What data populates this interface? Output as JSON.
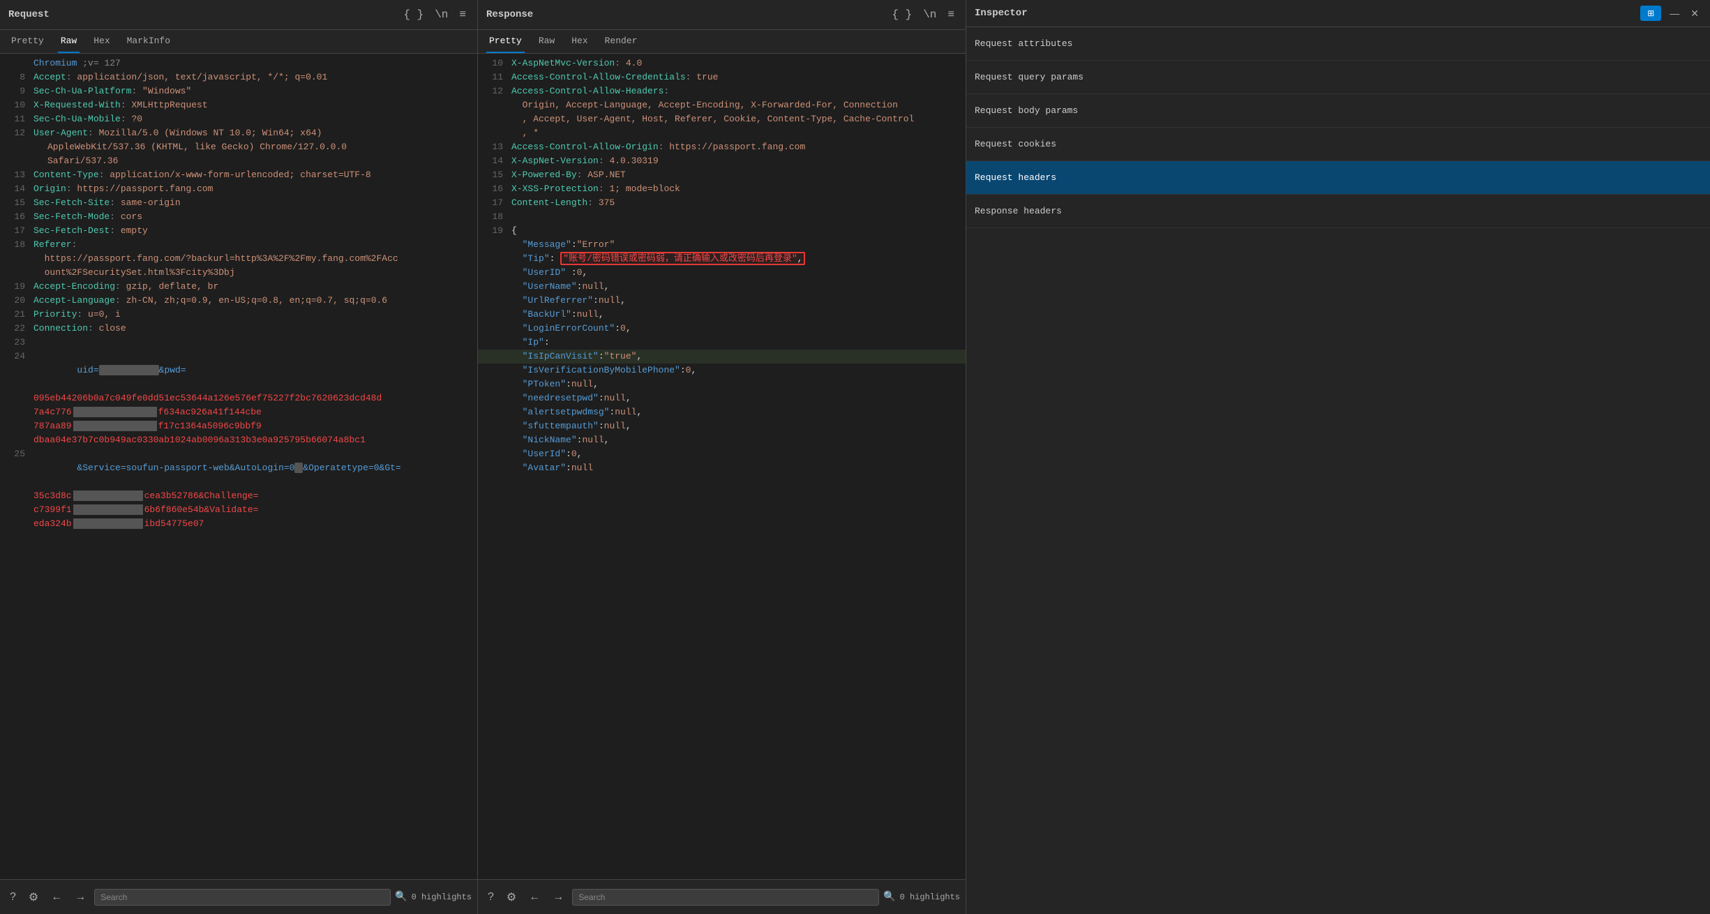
{
  "request": {
    "title": "Request",
    "tabs": [
      "Pretty",
      "Raw",
      "Hex",
      "MarkInfo"
    ],
    "active_tab": "Raw",
    "lines": [
      {
        "num": "",
        "content": "Chromium ;v= 127",
        "type": "plain"
      },
      {
        "num": "8",
        "content": "Accept: application/json, text/javascript, */*; q=0.01",
        "key": "Accept",
        "val": "application/json, text/javascript, */*; q=0.01"
      },
      {
        "num": "9",
        "content": "Sec-Ch-Ua-Platform: \"Windows\"",
        "key": "Sec-Ch-Ua-Platform",
        "val": "\"Windows\""
      },
      {
        "num": "10",
        "content": "X-Requested-With: XMLHttpRequest",
        "key": "X-Requested-With",
        "val": "XMLHttpRequest"
      },
      {
        "num": "11",
        "content": "Sec-Ch-Ua-Mobile: ?0",
        "key": "Sec-Ch-Ua-Mobile",
        "val": "?0"
      },
      {
        "num": "12",
        "content": "User-Agent: Mozilla/5.0 (Windows NT 10.0; Win64; x64) AppleWebKit/537.36 (KHTML, like Gecko) Chrome/127.0.0.0 Safari/537.36",
        "key": "User-Agent",
        "val": "Mozilla/5.0 (Windows NT 10.0; Win64; x64) AppleWebKit/537.36 (KHTML, like Gecko) Chrome/127.0.0.0 Safari/537.36"
      },
      {
        "num": "13",
        "content": "Content-Type: application/x-www-form-urlencoded; charset=UTF-8",
        "key": "Content-Type",
        "val": "application/x-www-form-urlencoded; charset=UTF-8"
      },
      {
        "num": "14",
        "content": "Origin: https://passport.fang.com",
        "key": "Origin",
        "val": "https://passport.fang.com"
      },
      {
        "num": "15",
        "content": "Sec-Fetch-Site: same-origin",
        "key": "Sec-Fetch-Site",
        "val": "same-origin"
      },
      {
        "num": "16",
        "content": "Sec-Fetch-Mode: cors",
        "key": "Sec-Fetch-Mode",
        "val": "cors"
      },
      {
        "num": "17",
        "content": "Sec-Fetch-Dest: empty",
        "key": "Sec-Fetch-Dest",
        "val": "empty"
      },
      {
        "num": "18",
        "content": "Referer:",
        "key": "Referer",
        "val": ""
      },
      {
        "num": "",
        "content": "  https://passport.fang.com/?backurl=http%3A%2F%2Fmy.fang.com%2FAcc ount%2FSecuritySet.html%3Fcity%3Dbj",
        "type": "continuation"
      },
      {
        "num": "19",
        "content": "Accept-Encoding: gzip, deflate, br",
        "key": "Accept-Encoding",
        "val": "gzip, deflate, br"
      },
      {
        "num": "20",
        "content": "Accept-Language: zh-CN, zh;q=0.9, en-US;q=0.8, en;q=0.7, sq;q=0.6",
        "key": "Accept-Language",
        "val": "zh-CN, zh;q=0.9, en-US;q=0.8, en;q=0.7, sq;q=0.6"
      },
      {
        "num": "21",
        "content": "Priority: u=0, i",
        "key": "Priority",
        "val": "u=0, i"
      },
      {
        "num": "22",
        "content": "Connection: close",
        "key": "Connection",
        "val": "close"
      },
      {
        "num": "23",
        "content": "",
        "type": "empty"
      },
      {
        "num": "24",
        "content": "uid=REDACTED1&pwd=",
        "type": "redacted_line"
      },
      {
        "num": "",
        "content": "095eb44206b0a7c049fe0dd51ec53644a126e576ef75227f2bc7620623dcd48d",
        "type": "redacted_part"
      },
      {
        "num": "",
        "content": "7a4c776                          f634ac926a41f144cbe",
        "type": "redacted_part"
      },
      {
        "num": "",
        "content": "787aa89                          f17c1364a5096c9bbf9",
        "type": "redacted_part"
      },
      {
        "num": "",
        "content": "dbaa04e37b7c0b949ac0330ab1024ab0096a313b3e0a925795b66074a8bc1",
        "type": "redacted_part"
      },
      {
        "num": "25",
        "content": "&Service=soufun-passport-web&AutoLogin=0&Operatetype=0&Gt=",
        "type": "redacted_url"
      },
      {
        "num": "",
        "content": "35c3d8c               cea3b52786&Challenge=",
        "type": "redacted_part"
      },
      {
        "num": "",
        "content": "c7399f1               6b6f860e54b&Validate=",
        "type": "redacted_part"
      },
      {
        "num": "",
        "content": "eda324b               ibd54775e07",
        "type": "redacted_part"
      }
    ],
    "bottom": {
      "search_placeholder": "Search",
      "highlights": "0 highlights"
    }
  },
  "response": {
    "title": "Response",
    "tabs": [
      "Pretty",
      "Raw",
      "Hex",
      "Render"
    ],
    "active_tab": "Pretty",
    "lines": [
      {
        "num": "10",
        "content": "X-AspNetMvc-Version: 4.0",
        "key": "X-AspNetMvc-Version",
        "val": "4.0"
      },
      {
        "num": "11",
        "content": "Access-Control-Allow-Credentials: true",
        "key": "Access-Control-Allow-Credentials",
        "val": "true"
      },
      {
        "num": "12",
        "content": "Access-Control-Allow-Headers:",
        "key": "Access-Control-Allow-Headers",
        "val": ""
      },
      {
        "num": "",
        "content": "  Origin, Accept-Language, Accept-Encoding, X-Forwarded-For, Connection, Accept, User-Agent, Host, Referer, Cookie, Content-Type, Cache-Control, *",
        "type": "continuation"
      },
      {
        "num": "13",
        "content": "Access-Control-Allow-Origin: https://passport.fang.com",
        "key": "Access-Control-Allow-Origin",
        "val": "https://passport.fang.com"
      },
      {
        "num": "14",
        "content": "X-AspNet-Version: 4.0.30319",
        "key": "X-AspNet-Version",
        "val": "4.0.30319"
      },
      {
        "num": "15",
        "content": "X-Powered-By: ASP.NET",
        "key": "X-Powered-By",
        "val": "ASP.NET"
      },
      {
        "num": "16",
        "content": "X-XSS-Protection: 1; mode=block",
        "key": "X-XSS-Protection",
        "val": "1; mode=block"
      },
      {
        "num": "17",
        "content": "Content-Length: 375",
        "key": "Content-Length",
        "val": "375"
      },
      {
        "num": "18",
        "content": "",
        "type": "empty"
      },
      {
        "num": "19",
        "content": "{",
        "type": "brace"
      },
      {
        "num": "",
        "content": "  \"Message\":\"Error\"",
        "type": "json_kv",
        "jkey": "Message",
        "jval": "Error"
      },
      {
        "num": "",
        "content": "  \"Tip\": \"账号/密码错误或密码弱，请正确输入或改密码后再登录\",",
        "type": "json_highlight",
        "jkey": "Tip",
        "jval": "账号/密码错误或密码弱，请正确输入或改密码后再登录"
      },
      {
        "num": "",
        "content": "  \"UserID\":0,",
        "type": "json_kv",
        "jkey": "UserID",
        "jval": "0"
      },
      {
        "num": "",
        "content": "  \"UserName\":null,",
        "type": "json_kv",
        "jkey": "UserName",
        "jval": "null"
      },
      {
        "num": "",
        "content": "  \"UrlReferrer\":null,",
        "type": "json_kv",
        "jkey": "UrlReferrer",
        "jval": "null"
      },
      {
        "num": "",
        "content": "  \"BackUrl\":null,",
        "type": "json_kv",
        "jkey": "BackUrl",
        "jval": "null"
      },
      {
        "num": "",
        "content": "  \"LoginErrorCount\":0,",
        "type": "json_kv",
        "jkey": "LoginErrorCount",
        "jval": "0"
      },
      {
        "num": "",
        "content": "  \"Ip\":",
        "type": "json_kv_nocomma",
        "jkey": "Ip",
        "jval": ""
      },
      {
        "num": "",
        "content": "  \"IsIpCanVisit\":\"true\",",
        "type": "json_kv",
        "jkey": "IsIpCanVisit",
        "jval": "true"
      },
      {
        "num": "",
        "content": "  \"IsVerificationByMobilePhone\":0,",
        "type": "json_kv",
        "jkey": "IsVerificationByMobilePhone",
        "jval": "0"
      },
      {
        "num": "",
        "content": "  \"PToken\":null,",
        "type": "json_kv",
        "jkey": "PToken",
        "jval": "null"
      },
      {
        "num": "",
        "content": "  \"needresetpwd\":null,",
        "type": "json_kv",
        "jkey": "needresetpwd",
        "jval": "null"
      },
      {
        "num": "",
        "content": "  \"alertsetpwdmsg\":null,",
        "type": "json_kv",
        "jkey": "alertsetpwdmsg",
        "jval": "null"
      },
      {
        "num": "",
        "content": "  \"sfuttempauth\":null,",
        "type": "json_kv",
        "jkey": "sfuttempauth",
        "jval": "null"
      },
      {
        "num": "",
        "content": "  \"NickName\":null,",
        "type": "json_kv",
        "jkey": "NickName",
        "jval": "null"
      },
      {
        "num": "",
        "content": "  \"UserId\":0,",
        "type": "json_kv",
        "jkey": "UserId",
        "jval": "0"
      },
      {
        "num": "",
        "content": "  \"Avatar\":null",
        "type": "json_kv",
        "jkey": "Avatar",
        "jval": "null"
      }
    ],
    "bottom": {
      "search_placeholder": "Search",
      "highlights": "0 highlights"
    }
  },
  "inspector": {
    "title": "Inspector",
    "items": [
      {
        "label": "Request attributes",
        "active": false
      },
      {
        "label": "Request query params",
        "active": false
      },
      {
        "label": "Request body params",
        "active": false
      },
      {
        "label": "Request cookies",
        "active": false
      },
      {
        "label": "Request headers",
        "active": true
      },
      {
        "label": "Response headers",
        "active": false
      }
    ]
  },
  "toolbar": {
    "format_btn": "{ }",
    "newline_btn": "\\n",
    "menu_btn": "≡"
  }
}
